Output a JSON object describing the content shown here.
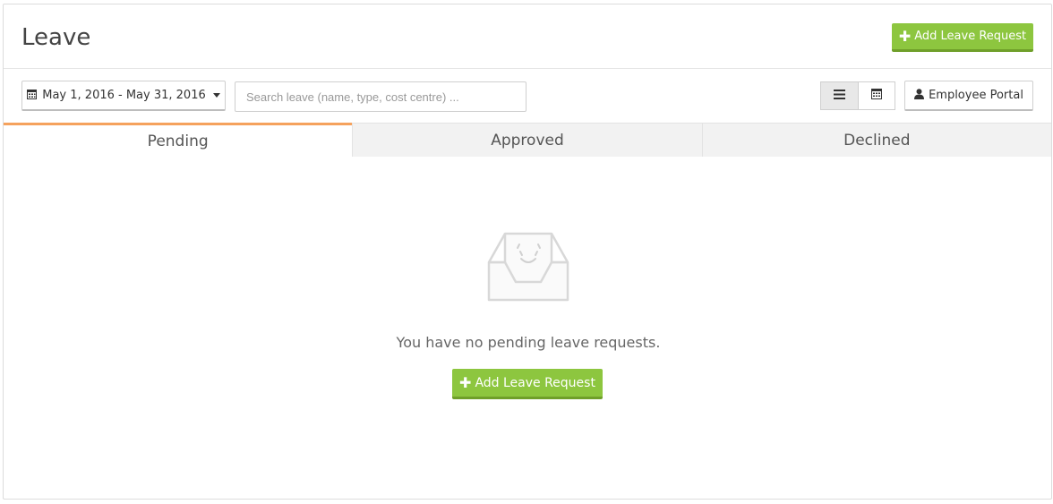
{
  "page": {
    "title": "Leave"
  },
  "header": {
    "add_button_label": "Add Leave Request",
    "add_icon": "plus-icon"
  },
  "toolbar": {
    "date_range": "May 1, 2016 - May 31, 2016",
    "date_icon": "calendar-icon",
    "search_placeholder": "Search leave (name, type, cost centre) ...",
    "search_value": "",
    "view_list_icon": "list-icon",
    "view_calendar_icon": "calendar-icon",
    "portal_label": "Employee Portal",
    "portal_icon": "user-icon"
  },
  "tabs": [
    {
      "label": "Pending",
      "active": true
    },
    {
      "label": "Approved",
      "active": false
    },
    {
      "label": "Declined",
      "active": false
    }
  ],
  "empty_state": {
    "icon": "empty-inbox-icon",
    "message": "You have no pending leave requests.",
    "add_button_label": "Add Leave Request"
  },
  "colors": {
    "accent_green": "#8dc63f",
    "active_tab_border": "#f5a25d"
  }
}
